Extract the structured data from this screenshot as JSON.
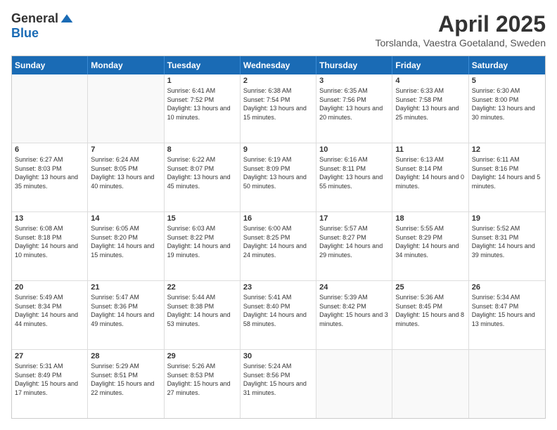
{
  "header": {
    "logo_general": "General",
    "logo_blue": "Blue",
    "main_title": "April 2025",
    "subtitle": "Torslanda, Vaestra Goetaland, Sweden"
  },
  "calendar": {
    "days": [
      "Sunday",
      "Monday",
      "Tuesday",
      "Wednesday",
      "Thursday",
      "Friday",
      "Saturday"
    ],
    "rows": [
      [
        {
          "day": "",
          "content": ""
        },
        {
          "day": "",
          "content": ""
        },
        {
          "day": "1",
          "content": "Sunrise: 6:41 AM\nSunset: 7:52 PM\nDaylight: 13 hours and 10 minutes."
        },
        {
          "day": "2",
          "content": "Sunrise: 6:38 AM\nSunset: 7:54 PM\nDaylight: 13 hours and 15 minutes."
        },
        {
          "day": "3",
          "content": "Sunrise: 6:35 AM\nSunset: 7:56 PM\nDaylight: 13 hours and 20 minutes."
        },
        {
          "day": "4",
          "content": "Sunrise: 6:33 AM\nSunset: 7:58 PM\nDaylight: 13 hours and 25 minutes."
        },
        {
          "day": "5",
          "content": "Sunrise: 6:30 AM\nSunset: 8:00 PM\nDaylight: 13 hours and 30 minutes."
        }
      ],
      [
        {
          "day": "6",
          "content": "Sunrise: 6:27 AM\nSunset: 8:03 PM\nDaylight: 13 hours and 35 minutes."
        },
        {
          "day": "7",
          "content": "Sunrise: 6:24 AM\nSunset: 8:05 PM\nDaylight: 13 hours and 40 minutes."
        },
        {
          "day": "8",
          "content": "Sunrise: 6:22 AM\nSunset: 8:07 PM\nDaylight: 13 hours and 45 minutes."
        },
        {
          "day": "9",
          "content": "Sunrise: 6:19 AM\nSunset: 8:09 PM\nDaylight: 13 hours and 50 minutes."
        },
        {
          "day": "10",
          "content": "Sunrise: 6:16 AM\nSunset: 8:11 PM\nDaylight: 13 hours and 55 minutes."
        },
        {
          "day": "11",
          "content": "Sunrise: 6:13 AM\nSunset: 8:14 PM\nDaylight: 14 hours and 0 minutes."
        },
        {
          "day": "12",
          "content": "Sunrise: 6:11 AM\nSunset: 8:16 PM\nDaylight: 14 hours and 5 minutes."
        }
      ],
      [
        {
          "day": "13",
          "content": "Sunrise: 6:08 AM\nSunset: 8:18 PM\nDaylight: 14 hours and 10 minutes."
        },
        {
          "day": "14",
          "content": "Sunrise: 6:05 AM\nSunset: 8:20 PM\nDaylight: 14 hours and 15 minutes."
        },
        {
          "day": "15",
          "content": "Sunrise: 6:03 AM\nSunset: 8:22 PM\nDaylight: 14 hours and 19 minutes."
        },
        {
          "day": "16",
          "content": "Sunrise: 6:00 AM\nSunset: 8:25 PM\nDaylight: 14 hours and 24 minutes."
        },
        {
          "day": "17",
          "content": "Sunrise: 5:57 AM\nSunset: 8:27 PM\nDaylight: 14 hours and 29 minutes."
        },
        {
          "day": "18",
          "content": "Sunrise: 5:55 AM\nSunset: 8:29 PM\nDaylight: 14 hours and 34 minutes."
        },
        {
          "day": "19",
          "content": "Sunrise: 5:52 AM\nSunset: 8:31 PM\nDaylight: 14 hours and 39 minutes."
        }
      ],
      [
        {
          "day": "20",
          "content": "Sunrise: 5:49 AM\nSunset: 8:34 PM\nDaylight: 14 hours and 44 minutes."
        },
        {
          "day": "21",
          "content": "Sunrise: 5:47 AM\nSunset: 8:36 PM\nDaylight: 14 hours and 49 minutes."
        },
        {
          "day": "22",
          "content": "Sunrise: 5:44 AM\nSunset: 8:38 PM\nDaylight: 14 hours and 53 minutes."
        },
        {
          "day": "23",
          "content": "Sunrise: 5:41 AM\nSunset: 8:40 PM\nDaylight: 14 hours and 58 minutes."
        },
        {
          "day": "24",
          "content": "Sunrise: 5:39 AM\nSunset: 8:42 PM\nDaylight: 15 hours and 3 minutes."
        },
        {
          "day": "25",
          "content": "Sunrise: 5:36 AM\nSunset: 8:45 PM\nDaylight: 15 hours and 8 minutes."
        },
        {
          "day": "26",
          "content": "Sunrise: 5:34 AM\nSunset: 8:47 PM\nDaylight: 15 hours and 13 minutes."
        }
      ],
      [
        {
          "day": "27",
          "content": "Sunrise: 5:31 AM\nSunset: 8:49 PM\nDaylight: 15 hours and 17 minutes."
        },
        {
          "day": "28",
          "content": "Sunrise: 5:29 AM\nSunset: 8:51 PM\nDaylight: 15 hours and 22 minutes."
        },
        {
          "day": "29",
          "content": "Sunrise: 5:26 AM\nSunset: 8:53 PM\nDaylight: 15 hours and 27 minutes."
        },
        {
          "day": "30",
          "content": "Sunrise: 5:24 AM\nSunset: 8:56 PM\nDaylight: 15 hours and 31 minutes."
        },
        {
          "day": "",
          "content": ""
        },
        {
          "day": "",
          "content": ""
        },
        {
          "day": "",
          "content": ""
        }
      ]
    ]
  }
}
